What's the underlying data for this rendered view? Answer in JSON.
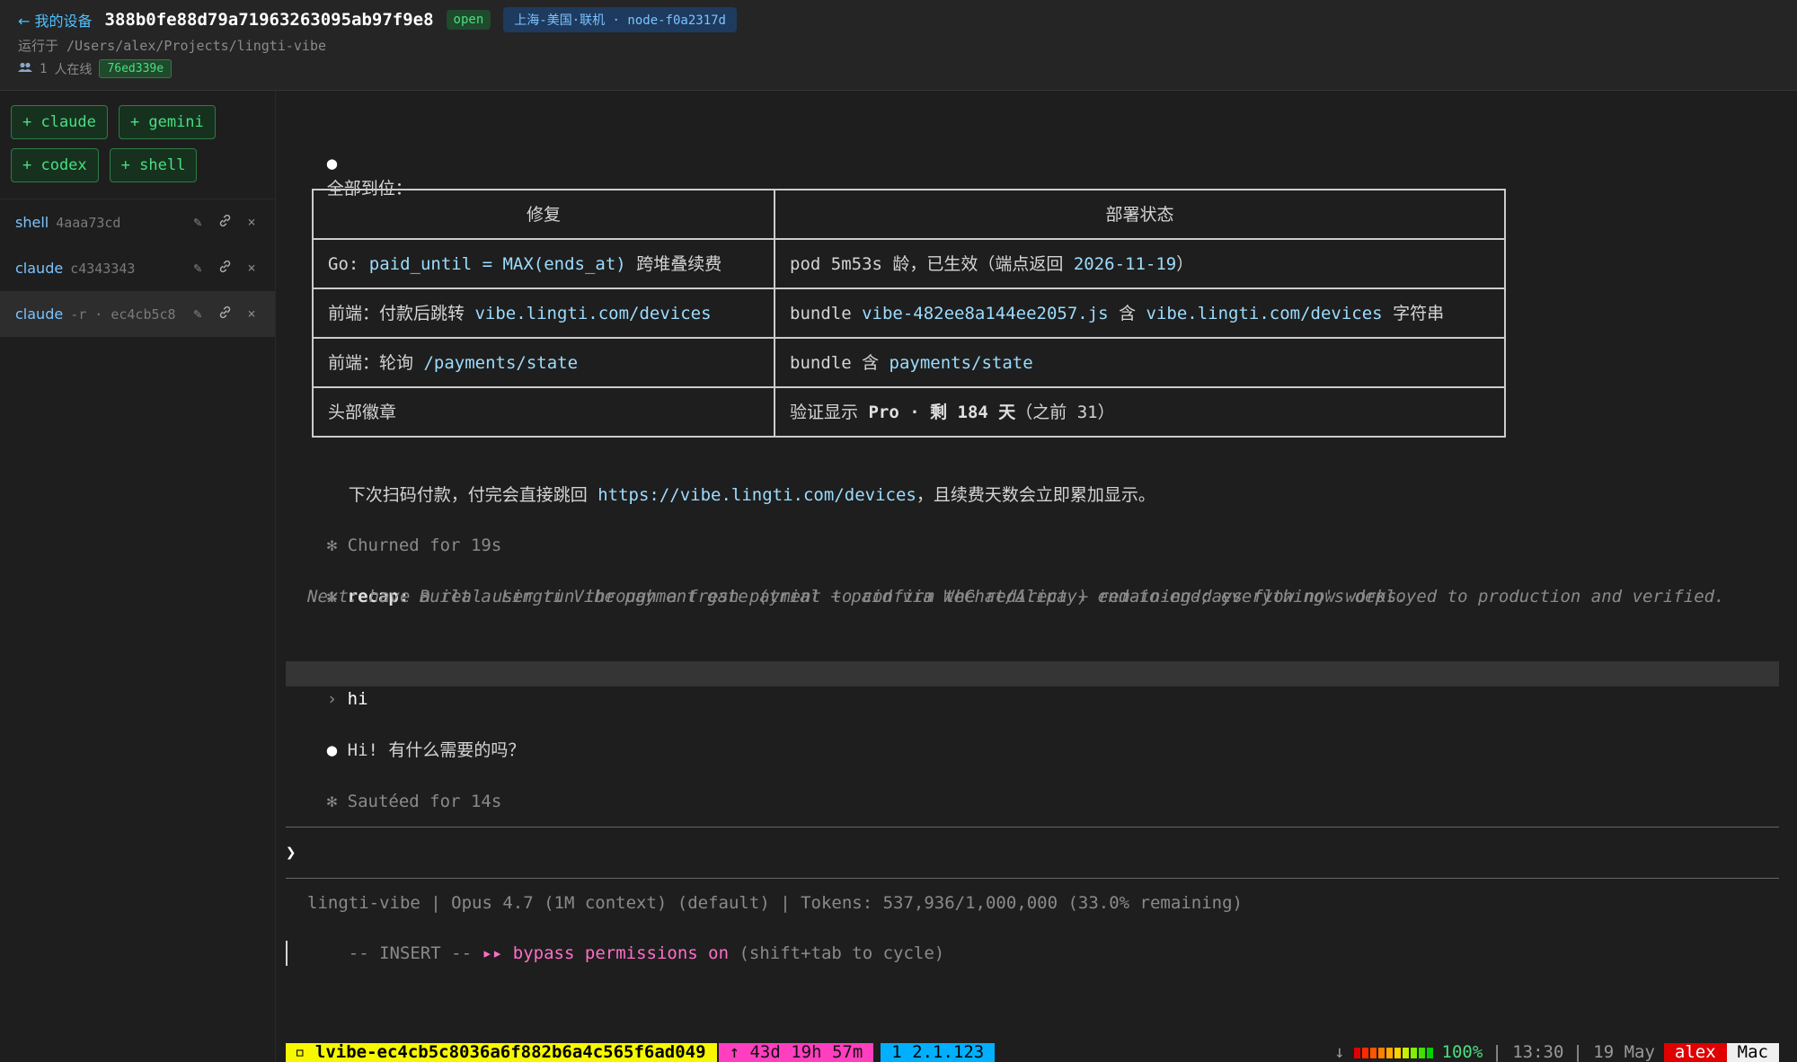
{
  "header": {
    "back_label": "← 我的设备",
    "device_id": "388b0fe88d79a71963263095ab97f9e8",
    "status_badge": "open",
    "node_badge": "上海-美国·联机 · node-f0a2317d",
    "running_at": "运行于 /Users/alex/Projects/lingti-vibe",
    "online_count": "1",
    "online_label": "人在线",
    "session_hash": "76ed339e",
    "users_icon": "users-icon"
  },
  "sidebar": {
    "spawn_buttons": [
      "+ claude",
      "+ gemini",
      "+ codex",
      "+ shell"
    ],
    "sessions": [
      {
        "kind": "shell",
        "id": "4aaa73cd"
      },
      {
        "kind": "claude",
        "id": "c4343343"
      },
      {
        "kind": "claude",
        "id": "-r · ec4cb5c8"
      }
    ],
    "action_icons": [
      "pencil-icon",
      "link-icon",
      "close-icon"
    ],
    "action_glyphs": {
      "edit": "✎",
      "link": "🔗",
      "close": "×"
    }
  },
  "terminal": {
    "bullet": "●",
    "star": "✻",
    "intro": "全部到位：",
    "table": {
      "headers": [
        "修复",
        "部署状态"
      ],
      "rows": [
        {
          "c1_pre": "Go: ",
          "c1_code": "paid_until = MAX(ends_at)",
          "c1_post": " 跨堆叠续费",
          "c2_pre": "pod 5m53s 龄，已生效（端点返回 ",
          "c2_code": "2026-11-19",
          "c2_post": "）",
          "c2_code2": "",
          "c2_post2": ""
        },
        {
          "c1_pre": "前端：付款后跳转 ",
          "c1_code": "vibe.lingti.com/devices",
          "c1_post": "",
          "c2_pre": "bundle ",
          "c2_code": "vibe-482ee8a144ee2057.js",
          "c2_post": " 含 ",
          "c2_code2": "vibe.lingti.com/devices",
          "c2_post2": " 字符串"
        },
        {
          "c1_pre": "前端：轮询 ",
          "c1_code": "/payments/state",
          "c1_post": "",
          "c2_pre": "bundle 含 ",
          "c2_code": "payments/state",
          "c2_post": "",
          "c2_code2": "",
          "c2_post2": ""
        },
        {
          "c1_pre": "头部徽章",
          "c1_code": "",
          "c1_post": "",
          "c2_pre": "验证显示 ",
          "c2_bold": "Pro · 剩 184 天",
          "c2_post": "（之前 31）"
        }
      ]
    },
    "next_pre": "下次扫码付款，付完会直接跳回 ",
    "next_url": "https://vibe.lingti.com/devices",
    "next_post": "，且续费天数会立即累加显示。",
    "churned": "Churned for 19s",
    "recap_label": "recap:",
    "recap_line1": "Built a Lingti Vibe payment gate (trial + paid via WeChat/Alipay) end-to-end; everything's deployed to production and verified.",
    "recap_line2": "Next: have a real user run through a fresh payment to confirm the redirect + remaining-days flow now works.",
    "user_prompt_glyph": "›",
    "user_msg": "hi",
    "reply": "Hi! 有什么需要的吗？",
    "sauteed": "Sautéed for 14s",
    "input_prompt": "❯",
    "status_line": "lingti-vibe | Opus 4.7 (1M context) (default) | Tokens: 537,936/1,000,000 (33.0% remaining)",
    "mode_pre": "-- INSERT -- ",
    "mode_bypass": "▸▸ bypass permissions on",
    "mode_post": " (shift+tab to cycle)"
  },
  "tmux": {
    "session": "▫ lvibe-ec4cb5c8036a6f882b6a4c565f6ad049",
    "uptime": "↑ 43d 19h 57m",
    "window": "1 2.1.123",
    "down_glyph": "↓",
    "battery": "100%",
    "time": "| 13:30",
    "date": "| 19 May",
    "user": "alex",
    "host": "Mac",
    "battery_level": 1.0,
    "bar_colors": [
      "#e00000",
      "#ff2a00",
      "#ff5500",
      "#ff8000",
      "#ffaa00",
      "#ffd000",
      "#c8f000",
      "#80f000",
      "#40e000",
      "#00d000"
    ]
  }
}
